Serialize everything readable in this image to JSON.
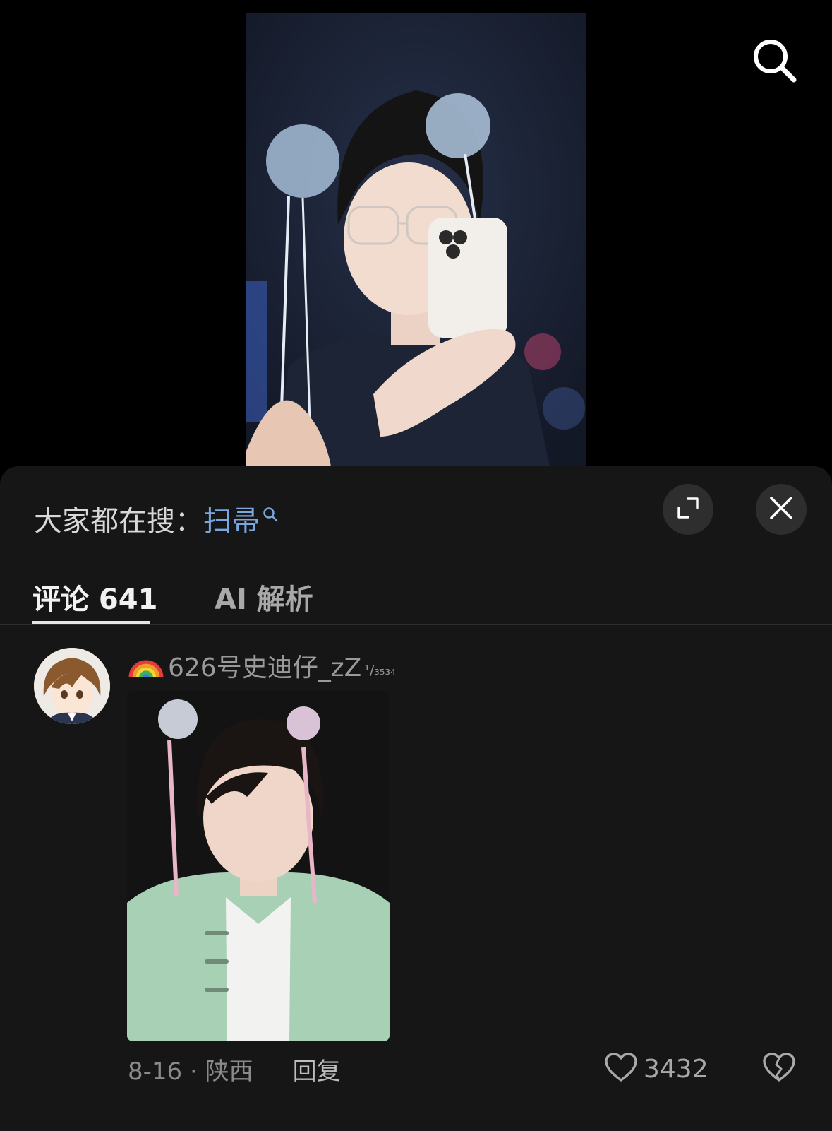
{
  "video": {
    "search_icon": "search-icon"
  },
  "sheet": {
    "hot_search": {
      "prefix": "大家都在搜：",
      "term": "扫帚"
    },
    "icons": {
      "expand": "expand-icon",
      "close": "close-icon"
    },
    "tabs": [
      {
        "label": "评论 641",
        "active": true
      },
      {
        "label": "AI 解析",
        "active": false
      }
    ]
  },
  "comment": {
    "username": "626号史迪仔_zZ",
    "badge": "¹/₃₅₃₄",
    "rainbow_icon": "rainbow-emoji",
    "date_location": "8-16 · 陕西",
    "reply_label": "回复",
    "like_count": "3432",
    "colors": {
      "username": "#9a9a9a",
      "link": "#7aa7e0",
      "sheet_bg": "#161616"
    }
  }
}
